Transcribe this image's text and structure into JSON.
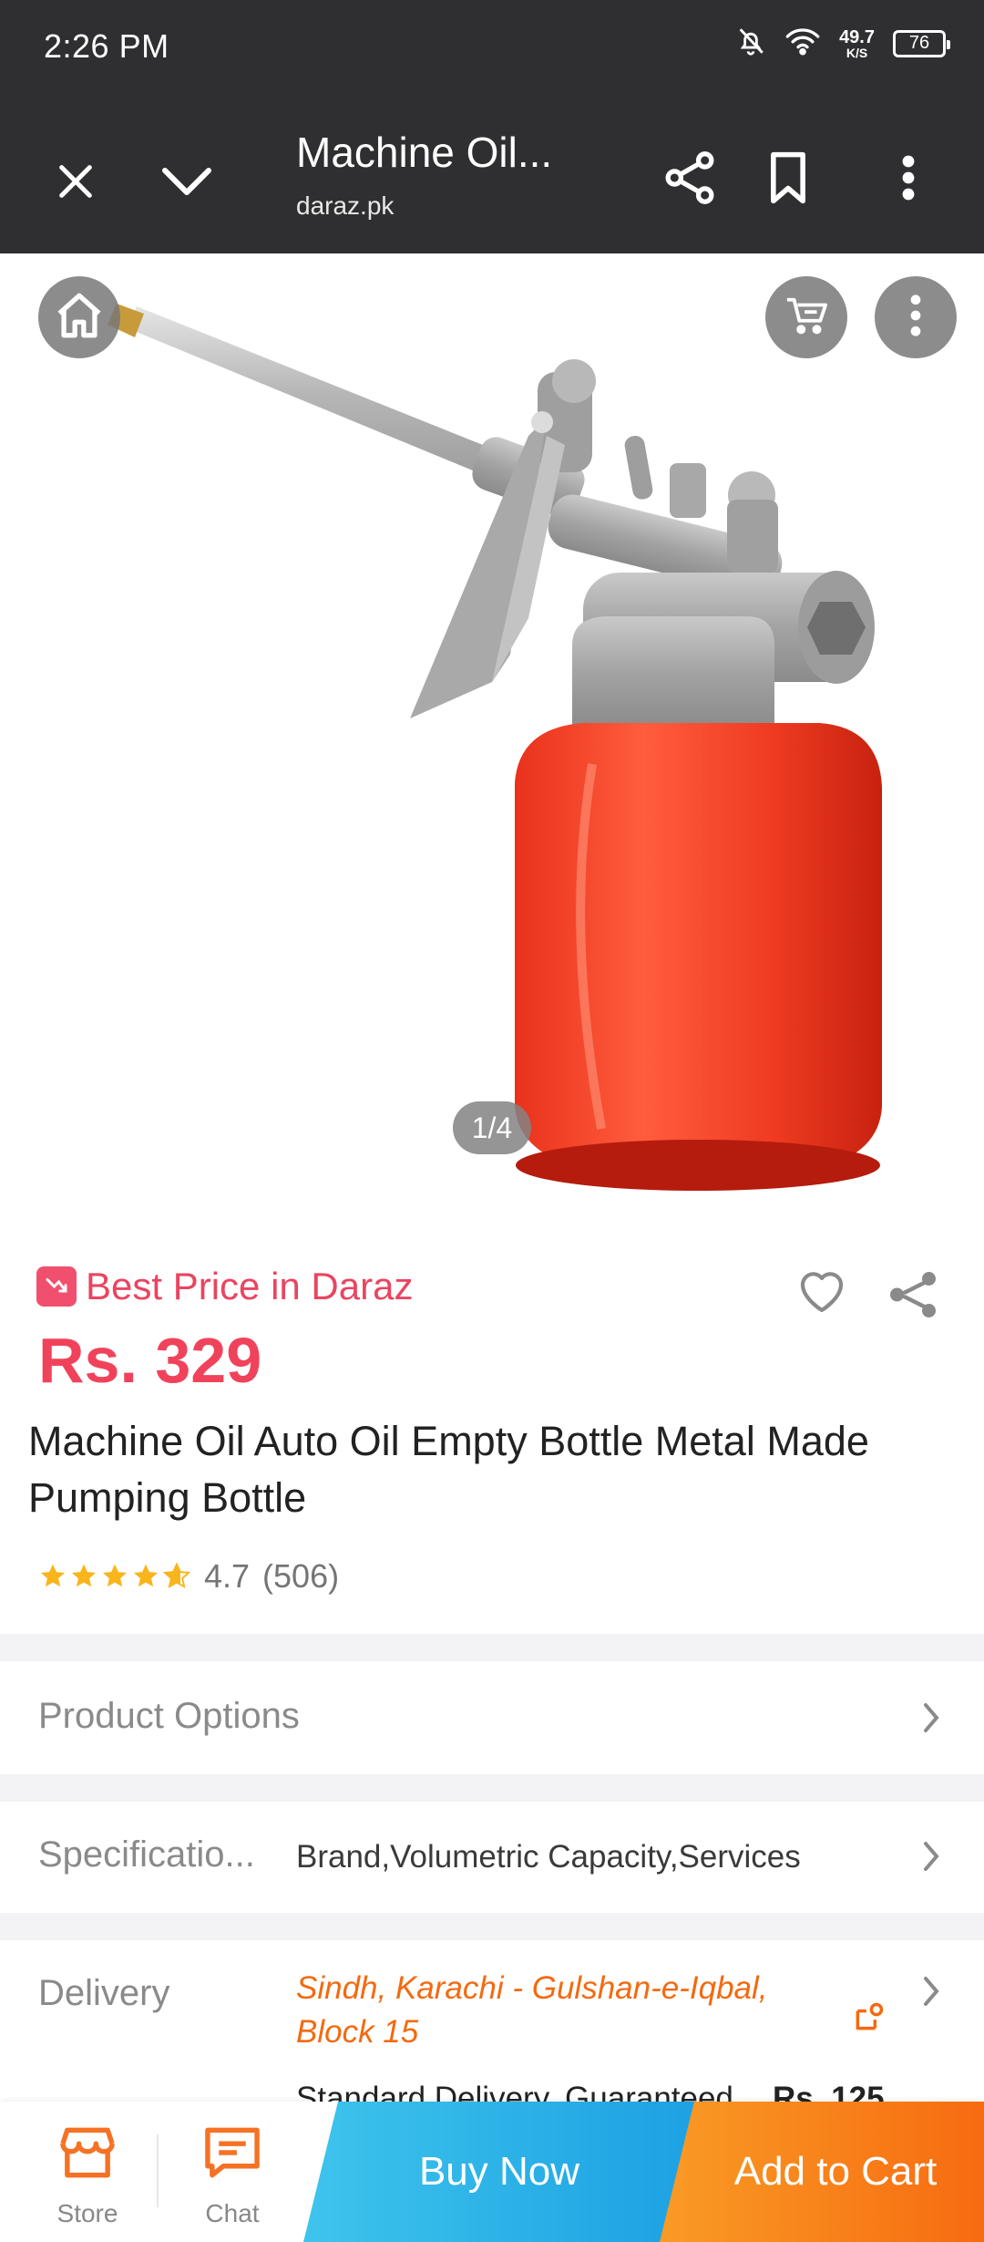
{
  "status_bar": {
    "time": "2:26 PM",
    "net_speed_value": "49.7",
    "net_speed_unit": "K/S",
    "battery": "76"
  },
  "browser": {
    "page_title": "Machine Oil...",
    "domain": "daraz.pk"
  },
  "gallery": {
    "counter": "1/4"
  },
  "product": {
    "best_price_label": "Best Price in Daraz",
    "price": "Rs. 329",
    "title": "Machine Oil Auto Oil Empty Bottle Metal Made Pumping Bottle",
    "rating": "4.7",
    "review_count": "(506)",
    "stars": 4.7
  },
  "rows": {
    "product_options": "Product Options",
    "specifications_label": "Specificatio...",
    "specifications_value": "Brand,Volumetric Capacity,Services",
    "delivery_label": "Delivery",
    "delivery_location": "Sindh, Karachi - Gulshan-e-Iqbal, Block 15",
    "standard_delivery": "Standard Delivery, Guaranteed...",
    "delivery_price": "Rs. 125"
  },
  "bottom_bar": {
    "store": "Store",
    "chat": "Chat",
    "buy_now": "Buy Now",
    "add_to_cart": "Add to Cart"
  },
  "colors": {
    "toolbar": "#2f2f31",
    "price": "#f0435b",
    "delivery_location": "#f36a10",
    "buy_now": "#1da1e3",
    "add_to_cart": "#f76b11",
    "store_icon": "#f57224"
  }
}
